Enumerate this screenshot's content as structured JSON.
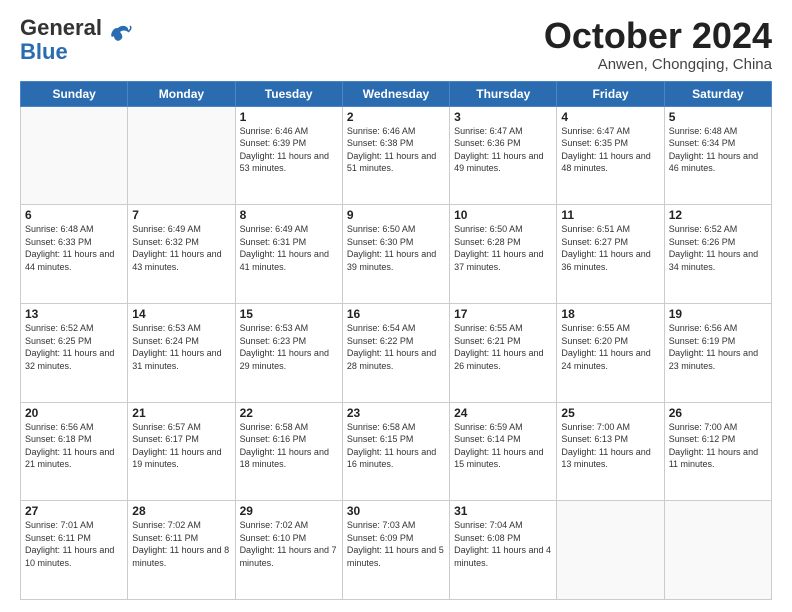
{
  "header": {
    "logo_general": "General",
    "logo_blue": "Blue",
    "month_title": "October 2024",
    "location": "Anwen, Chongqing, China"
  },
  "days_of_week": [
    "Sunday",
    "Monday",
    "Tuesday",
    "Wednesday",
    "Thursday",
    "Friday",
    "Saturday"
  ],
  "weeks": [
    [
      {
        "day": "",
        "info": ""
      },
      {
        "day": "",
        "info": ""
      },
      {
        "day": "1",
        "info": "Sunrise: 6:46 AM\nSunset: 6:39 PM\nDaylight: 11 hours and 53 minutes."
      },
      {
        "day": "2",
        "info": "Sunrise: 6:46 AM\nSunset: 6:38 PM\nDaylight: 11 hours and 51 minutes."
      },
      {
        "day": "3",
        "info": "Sunrise: 6:47 AM\nSunset: 6:36 PM\nDaylight: 11 hours and 49 minutes."
      },
      {
        "day": "4",
        "info": "Sunrise: 6:47 AM\nSunset: 6:35 PM\nDaylight: 11 hours and 48 minutes."
      },
      {
        "day": "5",
        "info": "Sunrise: 6:48 AM\nSunset: 6:34 PM\nDaylight: 11 hours and 46 minutes."
      }
    ],
    [
      {
        "day": "6",
        "info": "Sunrise: 6:48 AM\nSunset: 6:33 PM\nDaylight: 11 hours and 44 minutes."
      },
      {
        "day": "7",
        "info": "Sunrise: 6:49 AM\nSunset: 6:32 PM\nDaylight: 11 hours and 43 minutes."
      },
      {
        "day": "8",
        "info": "Sunrise: 6:49 AM\nSunset: 6:31 PM\nDaylight: 11 hours and 41 minutes."
      },
      {
        "day": "9",
        "info": "Sunrise: 6:50 AM\nSunset: 6:30 PM\nDaylight: 11 hours and 39 minutes."
      },
      {
        "day": "10",
        "info": "Sunrise: 6:50 AM\nSunset: 6:28 PM\nDaylight: 11 hours and 37 minutes."
      },
      {
        "day": "11",
        "info": "Sunrise: 6:51 AM\nSunset: 6:27 PM\nDaylight: 11 hours and 36 minutes."
      },
      {
        "day": "12",
        "info": "Sunrise: 6:52 AM\nSunset: 6:26 PM\nDaylight: 11 hours and 34 minutes."
      }
    ],
    [
      {
        "day": "13",
        "info": "Sunrise: 6:52 AM\nSunset: 6:25 PM\nDaylight: 11 hours and 32 minutes."
      },
      {
        "day": "14",
        "info": "Sunrise: 6:53 AM\nSunset: 6:24 PM\nDaylight: 11 hours and 31 minutes."
      },
      {
        "day": "15",
        "info": "Sunrise: 6:53 AM\nSunset: 6:23 PM\nDaylight: 11 hours and 29 minutes."
      },
      {
        "day": "16",
        "info": "Sunrise: 6:54 AM\nSunset: 6:22 PM\nDaylight: 11 hours and 28 minutes."
      },
      {
        "day": "17",
        "info": "Sunrise: 6:55 AM\nSunset: 6:21 PM\nDaylight: 11 hours and 26 minutes."
      },
      {
        "day": "18",
        "info": "Sunrise: 6:55 AM\nSunset: 6:20 PM\nDaylight: 11 hours and 24 minutes."
      },
      {
        "day": "19",
        "info": "Sunrise: 6:56 AM\nSunset: 6:19 PM\nDaylight: 11 hours and 23 minutes."
      }
    ],
    [
      {
        "day": "20",
        "info": "Sunrise: 6:56 AM\nSunset: 6:18 PM\nDaylight: 11 hours and 21 minutes."
      },
      {
        "day": "21",
        "info": "Sunrise: 6:57 AM\nSunset: 6:17 PM\nDaylight: 11 hours and 19 minutes."
      },
      {
        "day": "22",
        "info": "Sunrise: 6:58 AM\nSunset: 6:16 PM\nDaylight: 11 hours and 18 minutes."
      },
      {
        "day": "23",
        "info": "Sunrise: 6:58 AM\nSunset: 6:15 PM\nDaylight: 11 hours and 16 minutes."
      },
      {
        "day": "24",
        "info": "Sunrise: 6:59 AM\nSunset: 6:14 PM\nDaylight: 11 hours and 15 minutes."
      },
      {
        "day": "25",
        "info": "Sunrise: 7:00 AM\nSunset: 6:13 PM\nDaylight: 11 hours and 13 minutes."
      },
      {
        "day": "26",
        "info": "Sunrise: 7:00 AM\nSunset: 6:12 PM\nDaylight: 11 hours and 11 minutes."
      }
    ],
    [
      {
        "day": "27",
        "info": "Sunrise: 7:01 AM\nSunset: 6:11 PM\nDaylight: 11 hours and 10 minutes."
      },
      {
        "day": "28",
        "info": "Sunrise: 7:02 AM\nSunset: 6:11 PM\nDaylight: 11 hours and 8 minutes."
      },
      {
        "day": "29",
        "info": "Sunrise: 7:02 AM\nSunset: 6:10 PM\nDaylight: 11 hours and 7 minutes."
      },
      {
        "day": "30",
        "info": "Sunrise: 7:03 AM\nSunset: 6:09 PM\nDaylight: 11 hours and 5 minutes."
      },
      {
        "day": "31",
        "info": "Sunrise: 7:04 AM\nSunset: 6:08 PM\nDaylight: 11 hours and 4 minutes."
      },
      {
        "day": "",
        "info": ""
      },
      {
        "day": "",
        "info": ""
      }
    ]
  ]
}
